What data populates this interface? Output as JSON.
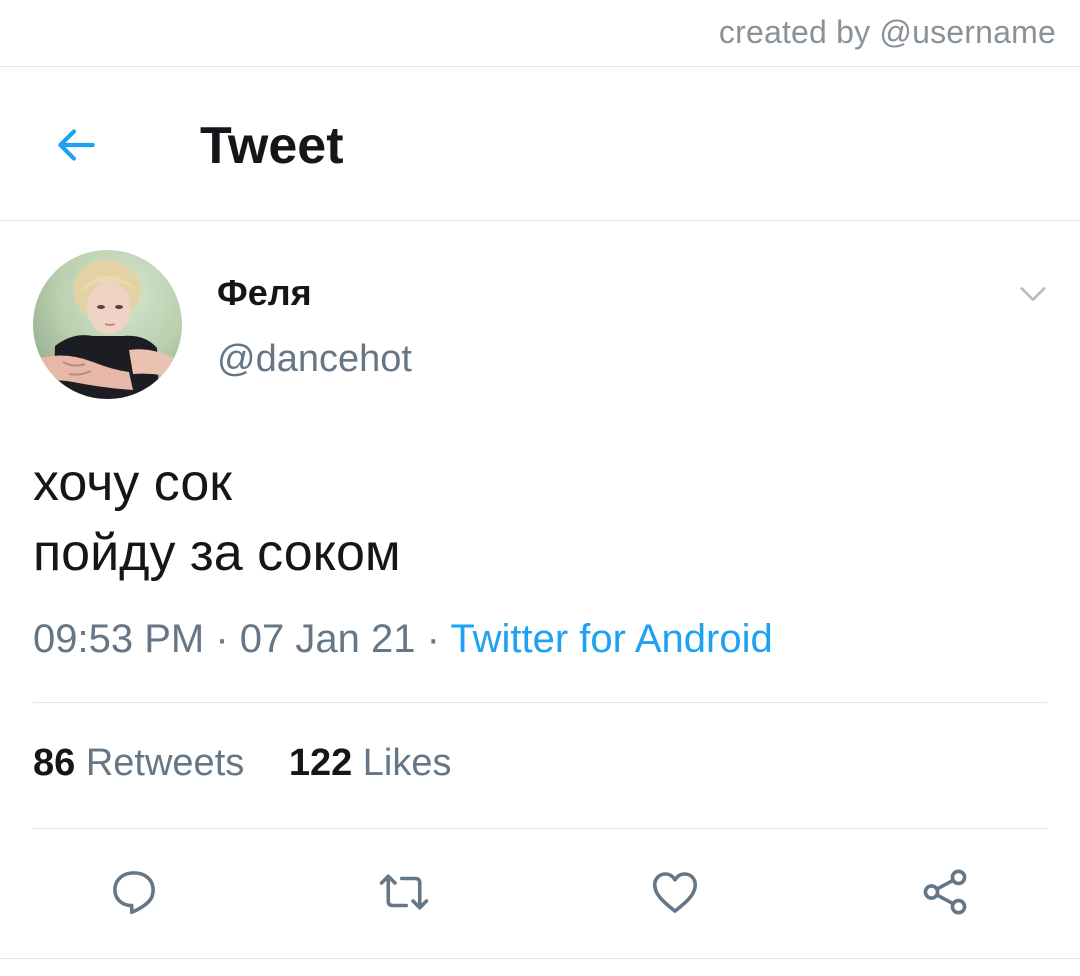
{
  "credit": "created by @username",
  "header": {
    "title": "Tweet",
    "back_icon": "arrow-left-icon"
  },
  "tweet": {
    "author": {
      "display_name": "Феля",
      "handle": "@dancehot"
    },
    "text_lines": [
      "хочу сок",
      "пойду за соком"
    ],
    "time": "09:53 PM",
    "date": "07 Jan 21",
    "separator": "·",
    "source": "Twitter for Android"
  },
  "stats": {
    "retweets_count": "86",
    "retweets_label": "Retweets",
    "likes_count": "122",
    "likes_label": "Likes"
  },
  "actions": [
    "reply-icon",
    "retweet-icon",
    "like-icon",
    "share-icon"
  ],
  "colors": {
    "accent": "#1da1f2",
    "text_primary": "#14171a",
    "text_secondary": "#657786",
    "divider": "#e1e8ed",
    "icon_gray": "#657786"
  }
}
